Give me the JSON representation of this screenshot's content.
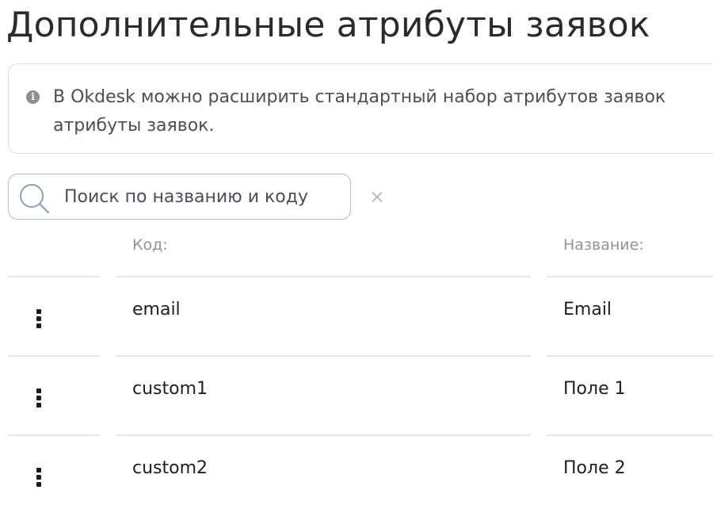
{
  "page_title": "Дополнительные атрибуты заявок",
  "info": {
    "icon": "info-circle-icon",
    "line1": "В Okdesk можно расширить стандартный набор атрибутов заявок",
    "line2": "атрибуты заявок."
  },
  "search": {
    "placeholder": "Поиск по названию и коду",
    "value": "",
    "icon": "search-icon",
    "clear_icon": "close-icon",
    "clear_glyph": "×"
  },
  "table": {
    "columns": [
      "",
      "Код:",
      "Название:"
    ],
    "rows": [
      {
        "code": "email",
        "name": "Email"
      },
      {
        "code": "custom1",
        "name": "Поле 1"
      },
      {
        "code": "custom2",
        "name": "Поле 2"
      }
    ]
  }
}
